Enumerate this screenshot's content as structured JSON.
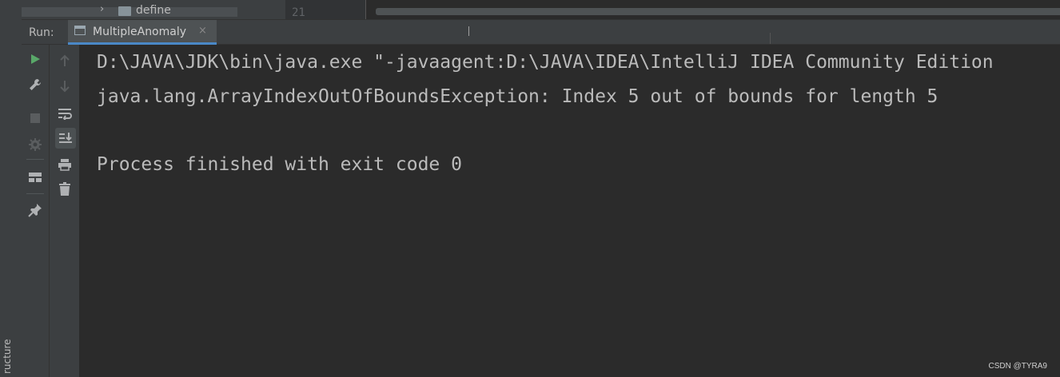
{
  "sidebar": {
    "structure_label": "ructure"
  },
  "project_tree": {
    "folder_label": "define"
  },
  "editor": {
    "line_number": "21"
  },
  "run_panel": {
    "run_label": "Run:",
    "tab_label": "MultipleAnomaly",
    "close_glyph": "×"
  },
  "console": {
    "lines": [
      "D:\\JAVA\\JDK\\bin\\java.exe \"-javaagent:D:\\JAVA\\IDEA\\IntelliJ IDEA Community Edition",
      "java.lang.ArrayIndexOutOfBoundsException: Index 5 out of bounds for length 5",
      "",
      "Process finished with exit code 0"
    ]
  },
  "watermark": "CSDN @TYRA9",
  "icons": {
    "toolbar1": [
      "run-icon",
      "wrench-icon",
      "stop-icon",
      "debug-settings-icon",
      "layout-icon",
      "pin-icon"
    ],
    "toolbar2": [
      "arrow-up-icon",
      "arrow-down-icon",
      "soft-wrap-icon",
      "scroll-to-end-icon",
      "print-icon",
      "trash-icon"
    ]
  },
  "colors": {
    "run_green": "#59a869",
    "tab_underline": "#4a88c7",
    "background": "#2b2b2b",
    "panel": "#3c3f41"
  }
}
